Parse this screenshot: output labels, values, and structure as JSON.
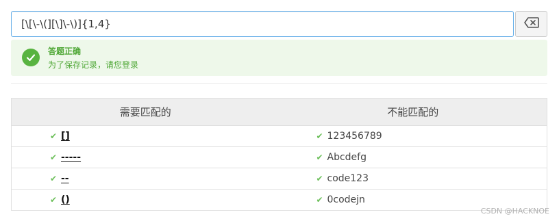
{
  "regex": {
    "value": "[\\[\\-\\(][\\]\\-\\)]{1,4}"
  },
  "alert": {
    "title": "答题正确",
    "subtitle": "为了保存记录，请您登录"
  },
  "table": {
    "headers": {
      "match": "需要匹配的",
      "nomatch": "不能匹配的"
    },
    "rows": [
      {
        "match": "[]",
        "nomatch": "123456789"
      },
      {
        "match": "-----",
        "nomatch": "Abcdefg"
      },
      {
        "match": "--",
        "nomatch": "code123"
      },
      {
        "match": "()",
        "nomatch": "0codejn"
      }
    ],
    "tick": "✔"
  },
  "watermark": "CSDN @HACKNOE",
  "colors": {
    "accent_border": "#66afe9",
    "success": "#58b340",
    "success_bg": "#eef8ea"
  }
}
